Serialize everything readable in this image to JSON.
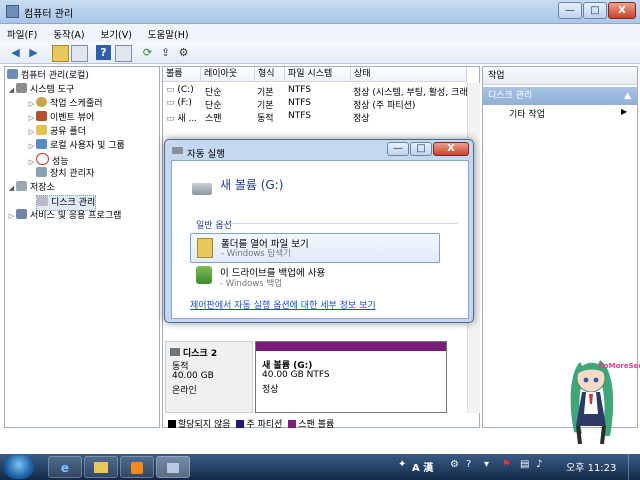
{
  "window": {
    "title": "컴퓨터 관리",
    "min_label": "—",
    "max_label": "□",
    "close_label": "X"
  },
  "menu": {
    "items": [
      "파일(F)",
      "동작(A)",
      "보기(V)",
      "도움말(H)"
    ]
  },
  "toolbar": {
    "icons": [
      "back-arrow-icon",
      "forward-arrow-icon",
      "up-folder-icon",
      "console-tree-icon",
      "help-icon",
      "properties-icon",
      "refresh-icon",
      "export-icon",
      "settings-icon"
    ]
  },
  "tree": {
    "root": "컴퓨터 관리(로컬)",
    "system_tools": "시스템 도구",
    "task_scheduler": "작업 스케줄러",
    "event_viewer": "이벤트 뷰어",
    "shared_folders": "공유 폴더",
    "local_users": "로컬 사용자 및 그룹",
    "performance": "성능",
    "device_manager": "장치 관리자",
    "storage": "저장소",
    "disk_management": "디스크 관리",
    "services": "서비스 및 응용 프로그램"
  },
  "volume_table": {
    "columns": [
      "볼륨",
      "레이아웃",
      "형식",
      "파일 시스템",
      "상태"
    ],
    "rows": [
      {
        "volume": "(C:)",
        "layout": "단순",
        "type": "기본",
        "fs": "NTFS",
        "status": "정상 (시스템, 부팅, 활성, 크래"
      },
      {
        "volume": "(F:)",
        "layout": "단순",
        "type": "기본",
        "fs": "NTFS",
        "status": "정상 (주 파티션)"
      },
      {
        "volume": "새 ...",
        "layout": "스팬",
        "type": "동적",
        "fs": "NTFS",
        "status": "정상"
      }
    ]
  },
  "disk2": {
    "name": "디스크 2",
    "type": "동적",
    "size": "40.00 GB",
    "state": "온라인",
    "partition_name": "새 볼륨  (G:)",
    "partition_size": "40.00 GB NTFS",
    "partition_state": "정상"
  },
  "legend": {
    "items": [
      {
        "label": "할당되지 않음",
        "color": "#000000"
      },
      {
        "label": "주 파티션",
        "color": "#1a1a7a"
      },
      {
        "label": "스팬 볼륨",
        "color": "#7b1d7b"
      }
    ]
  },
  "actions": {
    "header": "작업",
    "section": "디스크 관리",
    "more": "기타 작업"
  },
  "autoplay": {
    "title": "자동 실행",
    "volume": "새 볼륨 (G:)",
    "section": "일반 옵션",
    "option1_main": "폴더를 열어 파일 보기",
    "option1_sub": "- Windows 탐색기",
    "option2_main": "이 드라이브를 백업에 사용",
    "option2_sub": "- Windows 백업",
    "link": "제어판에서 자동 실행 옵션에 대한 세부 정보 보기"
  },
  "taskbar": {
    "ime": "A 漢",
    "time": "오후 11:23"
  },
  "mascot_label": "DoMoreSee"
}
